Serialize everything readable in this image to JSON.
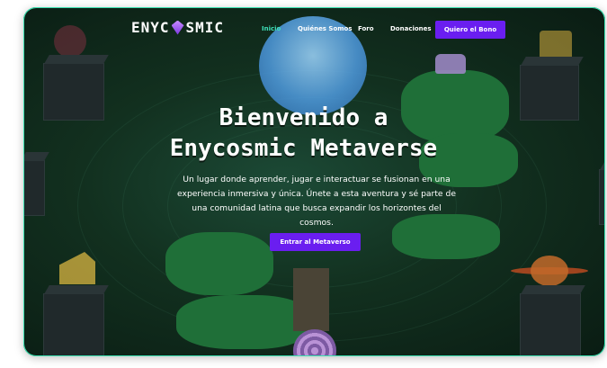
{
  "brand": {
    "logo_left": "ENYC",
    "logo_right": "SMIC"
  },
  "nav": {
    "links": [
      "Inicio",
      "Quiénes Somos",
      "Foro",
      "Donaciones"
    ],
    "cta_label": "Quiero el Bono"
  },
  "hero": {
    "title_line1": "Bienvenido a",
    "title_line2": "Enycosmic Metaverse",
    "description": "Un lugar donde aprender, jugar e interactuar se fusionan en una experiencia inmersiva y única. Únete a esta aventura y sé parte de una comunidad latina que busca expandir los horizontes del cosmos.",
    "button_label": "Entrar al Metaverso"
  },
  "colors": {
    "accent": "#6a1ef0",
    "active_link": "#3ee0b8",
    "frame_border": "#3ae0b0",
    "background": "#12301f"
  },
  "icons": [
    "gem-logo-icon"
  ]
}
